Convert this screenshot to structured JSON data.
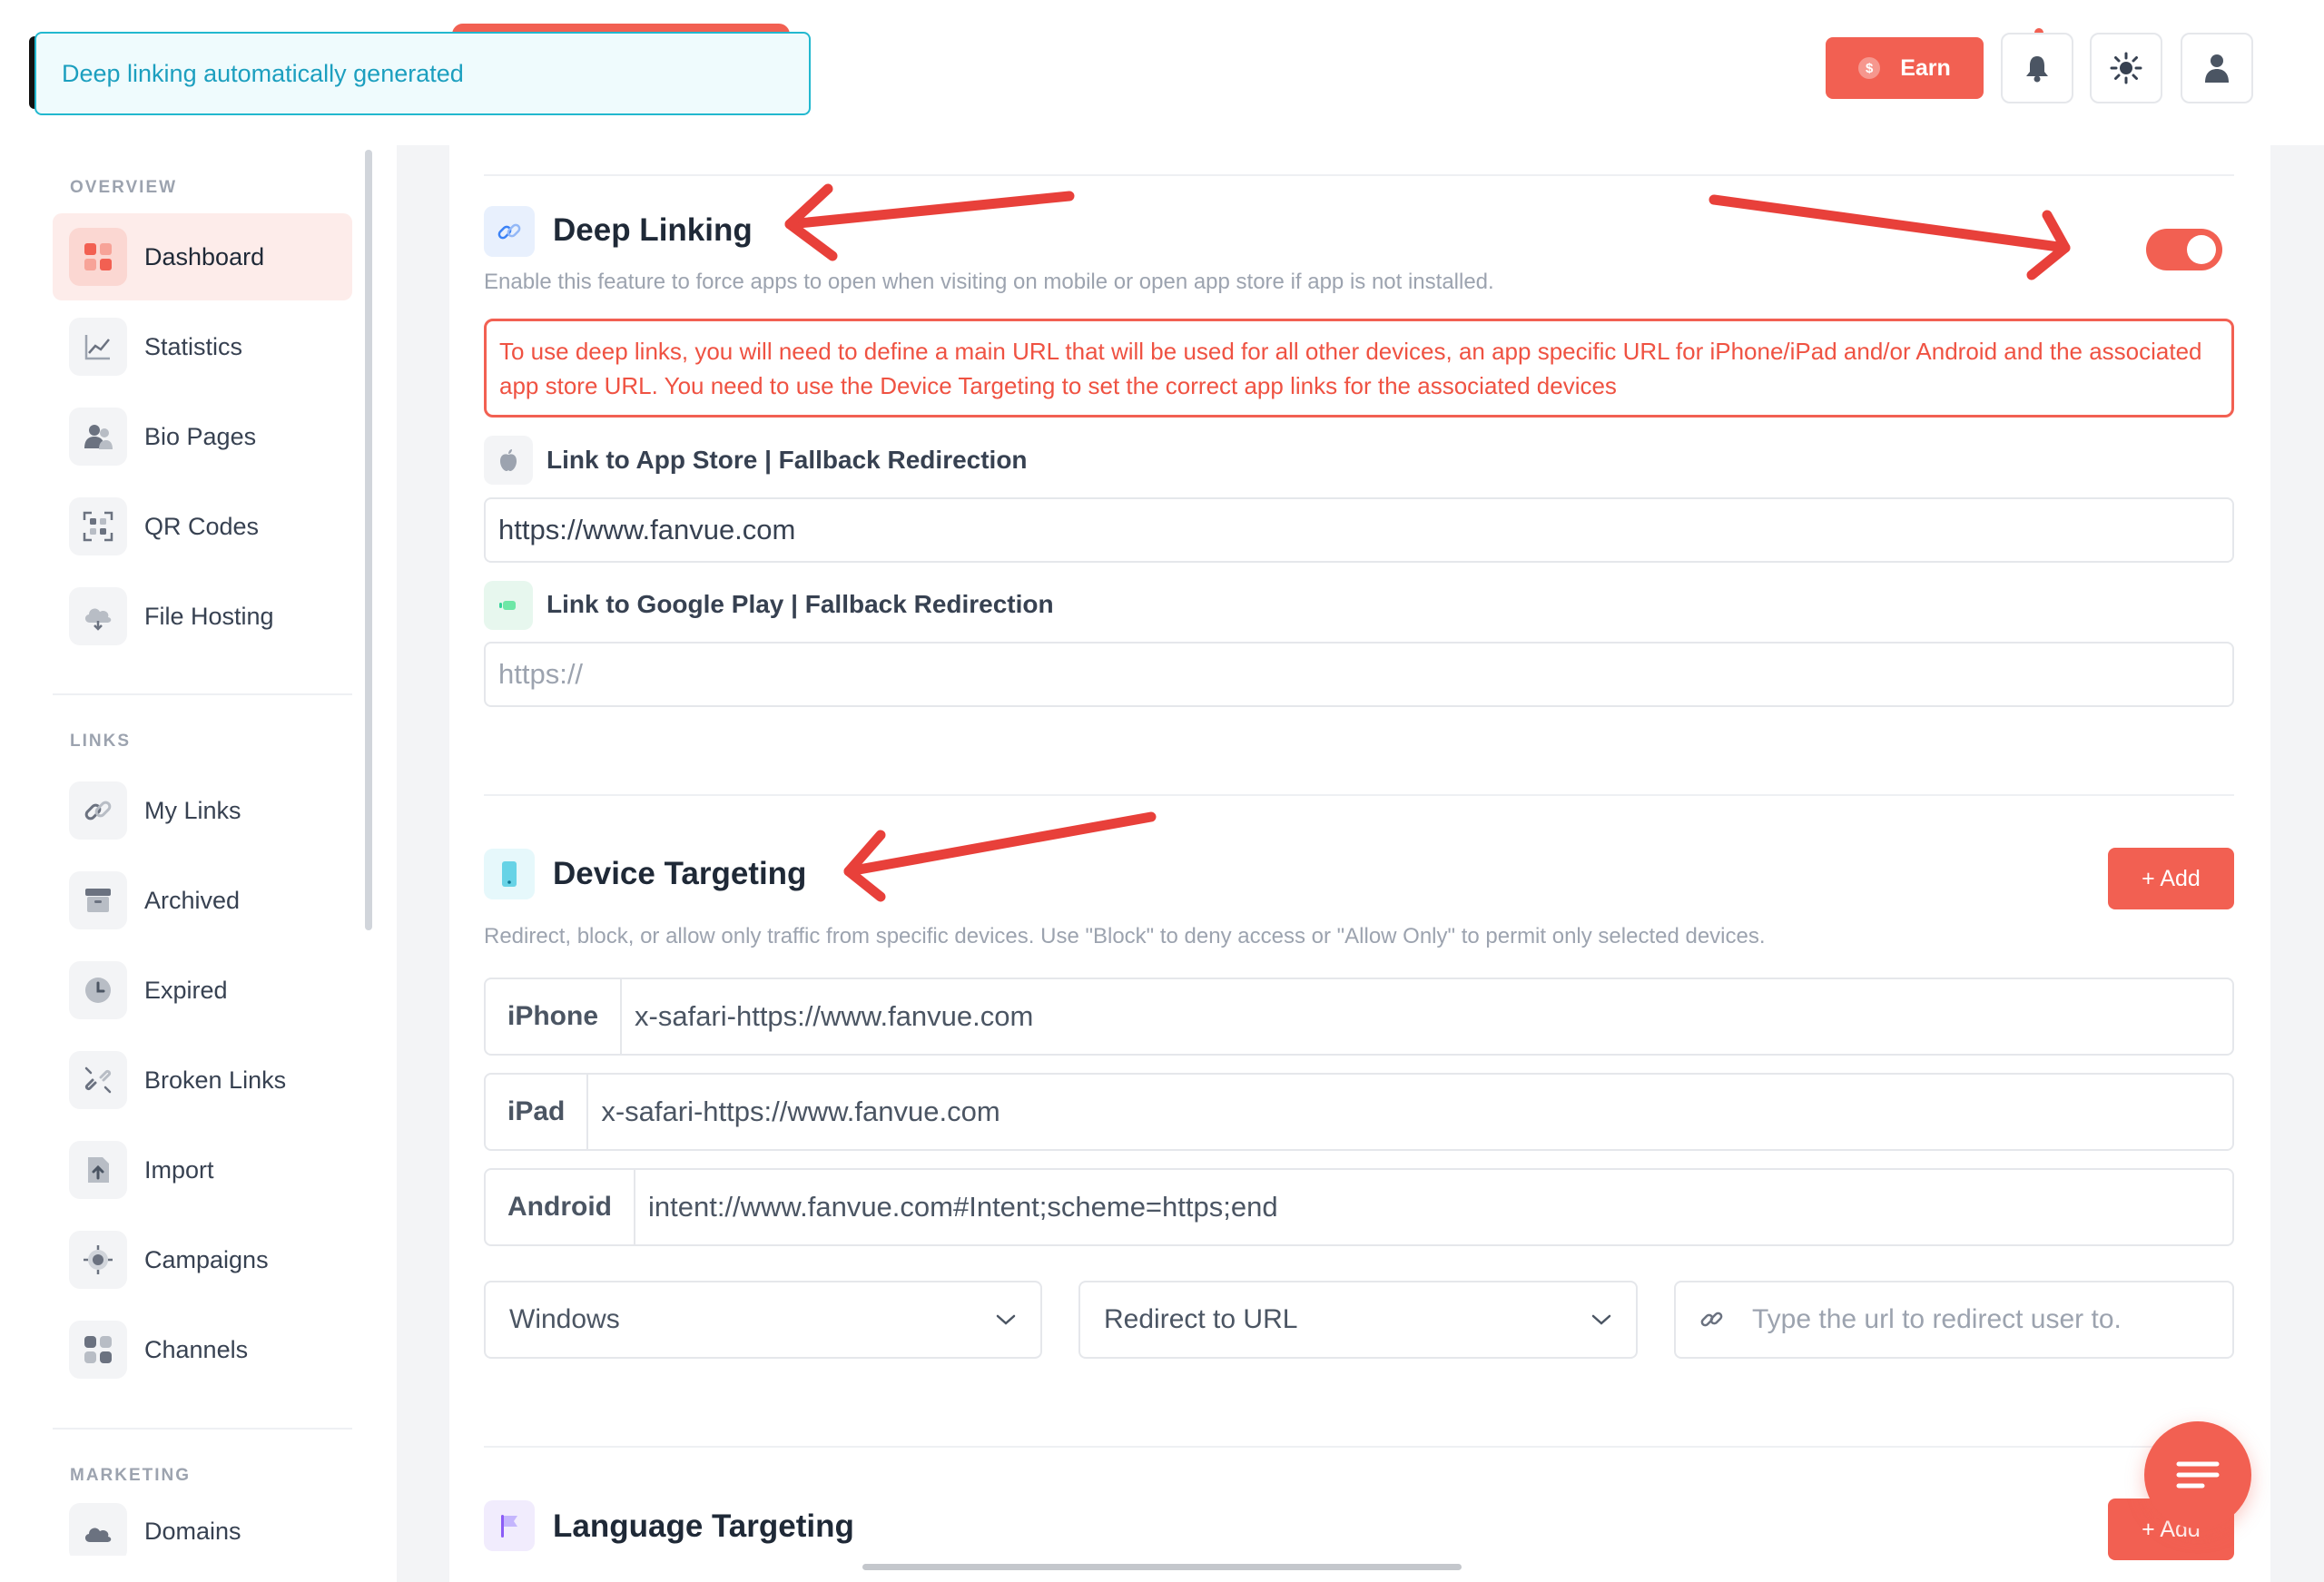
{
  "toast": {
    "message": "Deep linking automatically generated"
  },
  "header": {
    "earn_label": "Earn",
    "coin_symbol": "$"
  },
  "sidebar": {
    "sections": [
      {
        "title": "OVERVIEW"
      },
      {
        "title": "LINKS"
      },
      {
        "title": "MARKETING"
      }
    ],
    "items": [
      {
        "label": "Dashboard",
        "icon": "dashboard-icon",
        "active": true
      },
      {
        "label": "Statistics",
        "icon": "chart-icon"
      },
      {
        "label": "Bio Pages",
        "icon": "users-icon"
      },
      {
        "label": "QR Codes",
        "icon": "qr-icon"
      },
      {
        "label": "File Hosting",
        "icon": "cloud-icon"
      },
      {
        "label": "My Links",
        "icon": "link-icon"
      },
      {
        "label": "Archived",
        "icon": "archive-icon"
      },
      {
        "label": "Expired",
        "icon": "clock-icon"
      },
      {
        "label": "Broken Links",
        "icon": "broken-link-icon"
      },
      {
        "label": "Import",
        "icon": "import-icon"
      },
      {
        "label": "Campaigns",
        "icon": "target-icon"
      },
      {
        "label": "Channels",
        "icon": "grid-icon"
      },
      {
        "label": "Domains",
        "icon": "cloud-icon"
      }
    ]
  },
  "deep_linking": {
    "title": "Deep Linking",
    "description": "Enable this feature to force apps to open when visiting on mobile or open app store if app is not installed.",
    "enabled": true,
    "alert": "To use deep links, you will need to define a main URL that will be used for all other devices, an app specific URL for iPhone/iPad and/or Android and the associated app store URL. You need to use the Device Targeting to set the correct app links for the associated devices",
    "app_store_label": "Link to App Store | Fallback Redirection",
    "app_store_value": "https://www.fanvue.com",
    "google_play_label": "Link to Google Play | Fallback Redirection",
    "google_play_placeholder": "https://"
  },
  "device_targeting": {
    "title": "Device Targeting",
    "add_label": "+ Add",
    "description": "Redirect, block, or allow only traffic from specific devices. Use \"Block\" to deny access or \"Allow Only\" to permit only selected devices.",
    "rows": [
      {
        "device": "iPhone",
        "url": "x-safari-https://www.fanvue.com"
      },
      {
        "device": "iPad",
        "url": "x-safari-https://www.fanvue.com"
      },
      {
        "device": "Android",
        "url": "intent://www.fanvue.com#Intent;scheme=https;end"
      }
    ],
    "device_select": "Windows",
    "action_select": "Redirect to URL",
    "redirect_placeholder": "Type the url to redirect user to."
  },
  "language_targeting": {
    "title": "Language Targeting",
    "add_label": "+ Add"
  },
  "colors": {
    "accent": "#f26052",
    "toast_border": "#22b8cf",
    "toast_text": "#1c9fbf",
    "annotation_arrow": "#e8403a"
  }
}
